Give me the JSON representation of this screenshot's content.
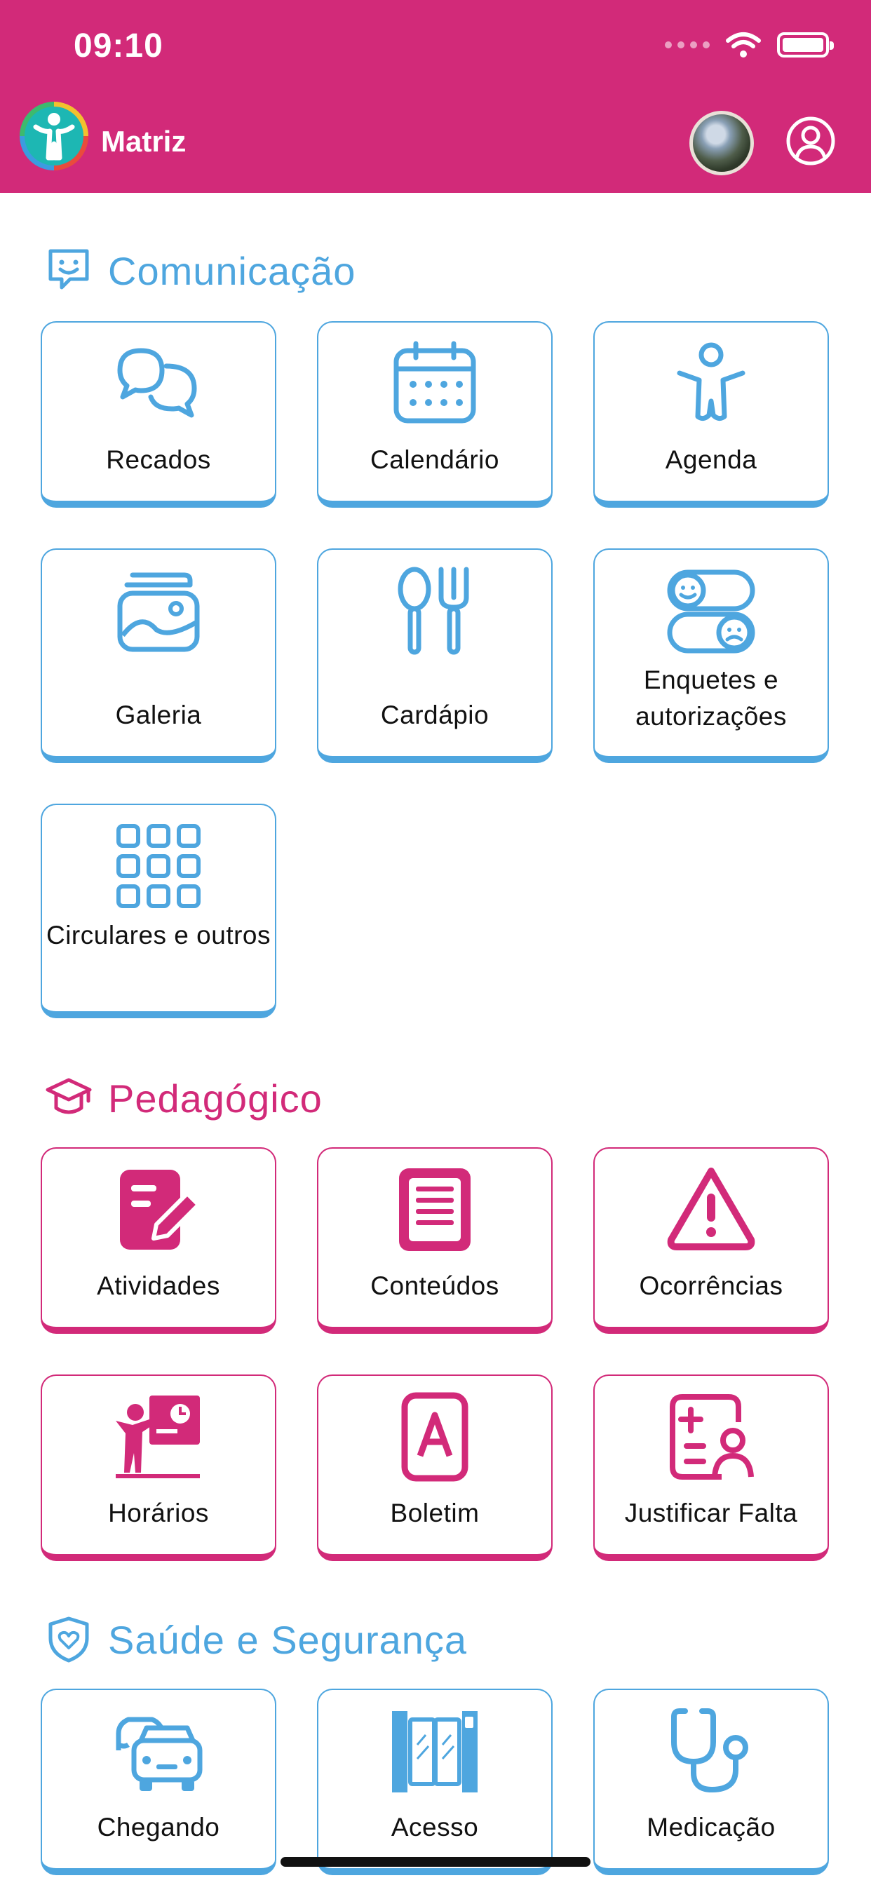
{
  "status_bar": {
    "time": "09:10"
  },
  "header": {
    "app_title": "Matriz"
  },
  "sections": [
    {
      "title": "Comunicação",
      "color": "#4EA6DF",
      "icon": "smiley-chat-icon",
      "cards": [
        {
          "label": "Recados",
          "icon": "chat-bubbles-icon"
        },
        {
          "label": "Calendário",
          "icon": "calendar-icon"
        },
        {
          "label": "Agenda",
          "icon": "child-figure-icon"
        },
        {
          "label": "Galeria",
          "icon": "photo-album-icon"
        },
        {
          "label": "Cardápio",
          "icon": "spoon-fork-icon"
        },
        {
          "label": "Enquetes e autorizações",
          "icon": "poll-toggle-icon"
        },
        {
          "label": "Circulares e outros",
          "icon": "apps-grid-icon"
        }
      ]
    },
    {
      "title": "Pedagógico",
      "color": "#D22A79",
      "icon": "graduation-cap-icon",
      "cards": [
        {
          "label": "Atividades",
          "icon": "document-pencil-icon"
        },
        {
          "label": "Conteúdos",
          "icon": "document-lines-icon"
        },
        {
          "label": "Ocorrências",
          "icon": "warning-triangle-icon"
        },
        {
          "label": "Horários",
          "icon": "teacher-board-icon"
        },
        {
          "label": "Boletim",
          "icon": "grade-a-icon"
        },
        {
          "label": "Justificar Falta",
          "icon": "justify-absence-icon"
        }
      ]
    },
    {
      "title": "Saúde e Segurança",
      "color": "#4EA6DF",
      "icon": "heart-shield-icon",
      "cards": [
        {
          "label": "Chegando",
          "icon": "cars-icon"
        },
        {
          "label": "Acesso",
          "icon": "gate-access-icon"
        },
        {
          "label": "Medicação",
          "icon": "stethoscope-icon"
        }
      ]
    }
  ]
}
